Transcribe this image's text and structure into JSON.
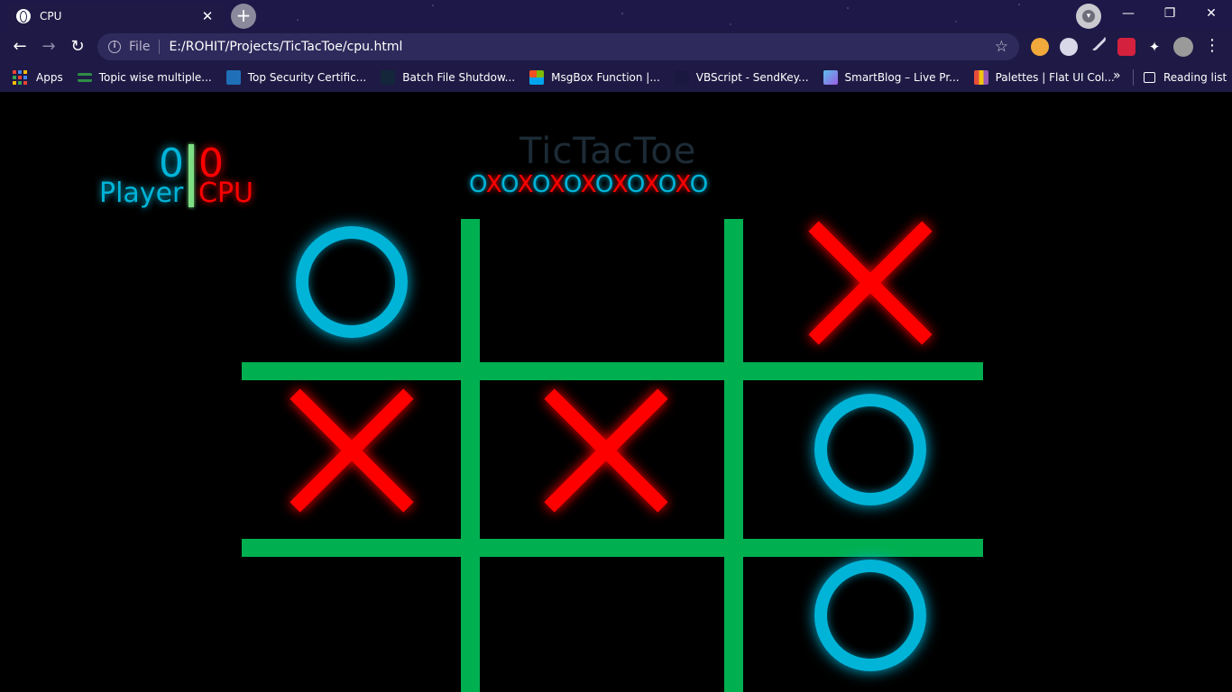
{
  "browser": {
    "tab_title": "CPU",
    "tab_close": "✕",
    "new_tab": "+",
    "window_minimize": "—",
    "window_restore": "❐",
    "window_close": "✕",
    "back": "←",
    "forward": "→",
    "reload": "↻",
    "info_icon": "i",
    "file_label": "File",
    "url": "E:/ROHIT/Projects/TicTacToe/cpu.html",
    "star": "☆",
    "menu": "⋮",
    "bookmarks": [
      {
        "label": "Apps"
      },
      {
        "label": "Topic wise multiple..."
      },
      {
        "label": "Top Security Certific..."
      },
      {
        "label": "Batch File Shutdow..."
      },
      {
        "label": "MsgBox Function |..."
      },
      {
        "label": "VBScript - SendKey..."
      },
      {
        "label": "SmartBlog – Live Pr..."
      },
      {
        "label": "Palettes | Flat UI Col..."
      }
    ],
    "bookmarks_more": "»",
    "reading_list": "Reading list"
  },
  "game": {
    "title": "TicTacToe",
    "score": {
      "player": "0",
      "cpu": "0",
      "player_label": "Player",
      "cpu_label": "CPU"
    },
    "marquee": [
      {
        "char": "O",
        "color": "#00b4d8"
      },
      {
        "char": "X",
        "color": "#ff0000"
      },
      {
        "char": "O",
        "color": "#00b4d8"
      },
      {
        "char": "X",
        "color": "#ff0000"
      },
      {
        "char": "O",
        "color": "#00b4d8"
      },
      {
        "char": "X",
        "color": "#ff0000"
      },
      {
        "char": "O",
        "color": "#00b4d8"
      },
      {
        "char": "X",
        "color": "#ff0000"
      },
      {
        "char": "O",
        "color": "#00b4d8"
      },
      {
        "char": "X",
        "color": "#ff0000"
      },
      {
        "char": "O",
        "color": "#00b4d8"
      },
      {
        "char": "X",
        "color": "#ff0000"
      },
      {
        "char": "O",
        "color": "#00b4d8"
      },
      {
        "char": "X",
        "color": "#ff0000"
      },
      {
        "char": "O",
        "color": "#00b4d8"
      }
    ],
    "board": [
      "O",
      "",
      "X",
      "X",
      "X",
      "O",
      "",
      "",
      "O"
    ],
    "colors": {
      "o": "#00b4d8",
      "x": "#ff0000",
      "grid": "#00b050",
      "background": "#000000"
    }
  }
}
